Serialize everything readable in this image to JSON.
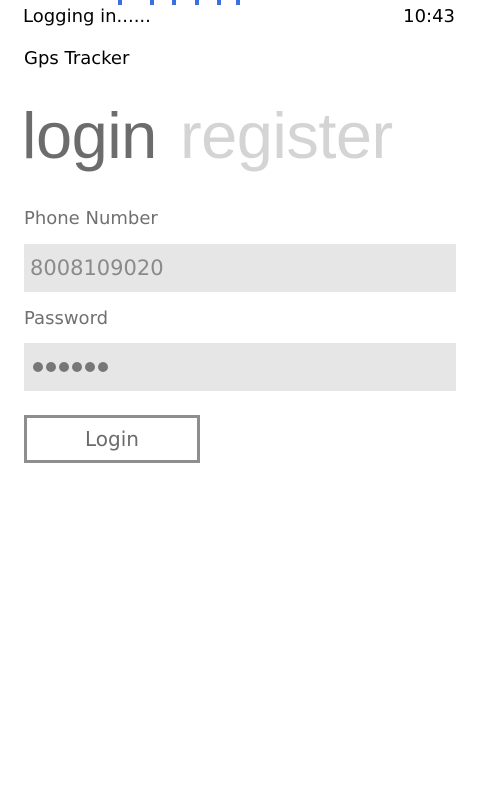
{
  "status_bar": {
    "status_text": "Logging in......",
    "time": "10:43"
  },
  "app": {
    "title": "Gps Tracker"
  },
  "pivot": {
    "tabs": [
      {
        "label": "login",
        "active": true
      },
      {
        "label": "register",
        "active": false
      }
    ]
  },
  "form": {
    "phone_label": "Phone Number",
    "phone_value": "8008109020",
    "password_label": "Password",
    "password_masked_length": 6,
    "login_button_label": "Login"
  },
  "colors": {
    "progress_accent": "#3b6fe0",
    "input_background": "#e6e6e6",
    "active_pivot": "#6c6c6c",
    "inactive_pivot": "#d4d4d4"
  },
  "icons": {
    "progress": "indeterminate-progress-dots",
    "password_mask": "password-dot"
  }
}
